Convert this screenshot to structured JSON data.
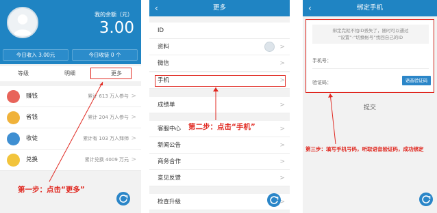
{
  "panel1": {
    "balance_label": "我的余额（元）",
    "balance_value": "3.00",
    "stat_income": "今日收入 3.00元",
    "stat_received": "今日收徒 0 个",
    "tabs": [
      "等级",
      "明细",
      "更多"
    ],
    "rows": [
      {
        "label": "赚钱",
        "meta": "累计 613 万人参与",
        "icon": "earn-icon",
        "color": "#e8645a"
      },
      {
        "label": "省钱",
        "meta": "累计 204 万人参与",
        "icon": "save-money-icon",
        "color": "#f0b23a"
      },
      {
        "label": "收徒",
        "meta": "累计有 103 万人拜师",
        "icon": "recruit-icon",
        "color": "#3f8fd2"
      },
      {
        "label": "兑换",
        "meta": "累计兑换 4009 万元",
        "icon": "exchange-icon",
        "color": "#f2c43c"
      }
    ],
    "step": "第一步：点击“更多”"
  },
  "panel2": {
    "title": "更多",
    "rows": [
      {
        "label": "ID"
      },
      {
        "label": "资料"
      },
      {
        "label": "微信"
      },
      {
        "label": "手机"
      },
      {
        "label": "成绩单"
      },
      {
        "label": "客服中心"
      },
      {
        "label": "新闻公告"
      },
      {
        "label": "商务合作"
      },
      {
        "label": "意见反馈"
      },
      {
        "label": "检查升级"
      }
    ],
    "step": "第二步：点击“手机”"
  },
  "panel3": {
    "title": "绑定手机",
    "notice_line1": "绑定完就不怕ID丢失了，随时可以通过",
    "notice_line2": "“设置”-“切换帐号”找回自己的ID",
    "phone_label": "手机号：",
    "code_label": "验证码：",
    "code_button": "语音验证码",
    "submit": "提交",
    "step": "第三步：填写手机号码，听取语音验证码，成功绑定"
  },
  "colors": {
    "primary": "#1f84c3",
    "annotation": "#e0271f"
  }
}
